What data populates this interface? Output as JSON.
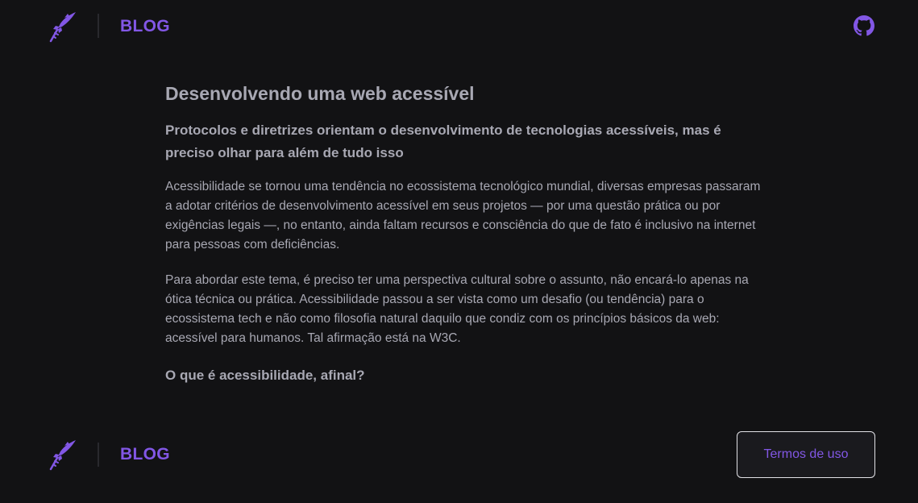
{
  "header": {
    "brand": "BLOG",
    "logo_icon": "feather-rocket-icon",
    "github_icon": "github-icon"
  },
  "post": {
    "title": "Desenvolvendo uma web acessível",
    "subtitle": "Protocolos e diretrizes orientam o desenvolvimento de tecnologias acessíveis, mas é preciso olhar para além de tudo isso",
    "paragraphs": [
      "Acessibilidade se tornou uma tendência no ecossistema tecnológico mundial, diversas empresas passaram a adotar critérios de desenvolvimento acessível em seus projetos — por uma questão prática ou por exigências legais —, no entanto, ainda faltam recursos e consciência do que de fato é inclusivo na internet para pessoas com deficiências.",
      "Para abordar este tema, é preciso ter uma perspectiva cultural sobre o assunto, não encará-lo apenas na ótica técnica ou prática. Acessibilidade passou a ser vista como um desafio (ou tendência) para o ecossistema tech e não como filosofia natural daquilo que condiz com os princípios básicos da web: acessível para humanos. Tal afirmação está na W3C."
    ],
    "section_heading": "O que é acessibilidade, afinal?"
  },
  "footer": {
    "brand": "BLOG",
    "terms_label": "Termos de uso"
  },
  "colors": {
    "background": "#121214",
    "accent": "#8257e5",
    "text": "#a8a8b3"
  }
}
